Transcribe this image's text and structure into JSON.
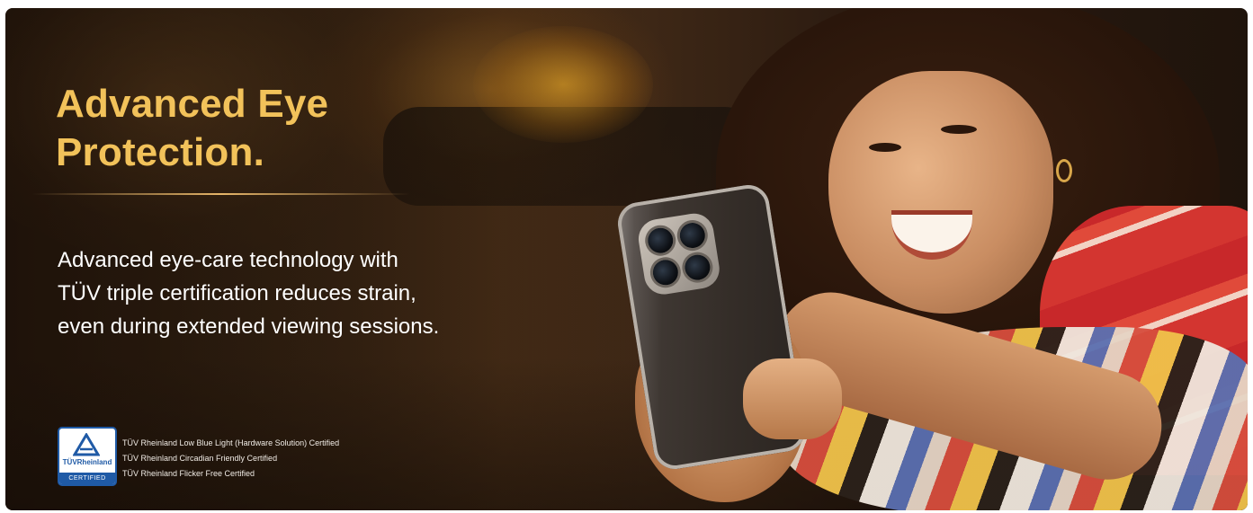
{
  "banner": {
    "headline": [
      "Advanced Eye",
      "Protection."
    ],
    "body": [
      "Advanced eye-care technology with",
      "TÜV triple certification reduces strain,",
      "even during extended viewing sessions."
    ],
    "headline_color": "#f2c25a",
    "body_color": "#ffffff"
  },
  "certification": {
    "badge_brand": "TÜVRheinland",
    "badge_label": "CERTIFIED",
    "badge_color": "#1f5aa6",
    "items": [
      "TÜV Rheinland Low Blue Light (Hardware Solution) Certified",
      "TÜV Rheinland Circadian Friendly Certified",
      "TÜV Rheinland Flicker Free Certified"
    ]
  }
}
